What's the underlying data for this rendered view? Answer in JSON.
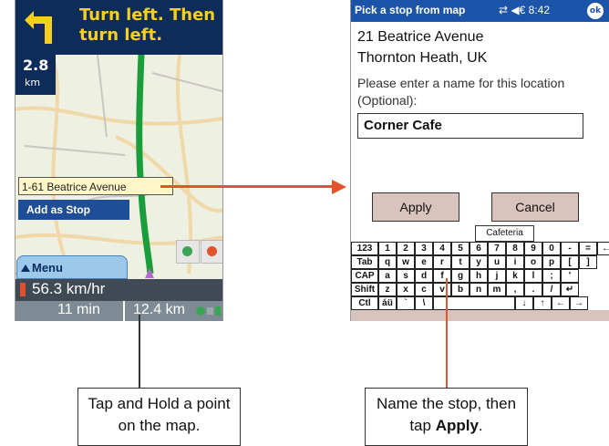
{
  "left_device": {
    "instruction": "Turn left.  Then turn left.",
    "distance_value": "2.8",
    "distance_unit": "km",
    "street_tooltip": "1-61 Beatrice Avenue",
    "add_stop_label": "Add as Stop",
    "menu_label": "Menu",
    "speed": "56.3 km/hr",
    "time_remaining": "11 min",
    "distance_remaining": "12.4 km"
  },
  "right_device": {
    "title": "Pick a stop from map",
    "status_time": "8:42",
    "ok_label": "ok",
    "address_line1": "21 Beatrice Avenue",
    "address_line2": "Thornton Heath, UK",
    "prompt": "Please enter a name for this location (Optional):",
    "name_value": "Corner Cafe",
    "apply_label": "Apply",
    "cancel_label": "Cancel",
    "suggestion": "Cafeteria",
    "keyboard_rows": [
      [
        "123",
        "1",
        "2",
        "3",
        "4",
        "5",
        "6",
        "7",
        "8",
        "9",
        "0",
        "-",
        "=",
        "←"
      ],
      [
        "Tab",
        "q",
        "w",
        "e",
        "r",
        "t",
        "y",
        "u",
        "i",
        "o",
        "p",
        "[",
        "]"
      ],
      [
        "CAP",
        "a",
        "s",
        "d",
        "f",
        "g",
        "h",
        "j",
        "k",
        "l",
        ";",
        "'"
      ],
      [
        "Shift",
        "z",
        "x",
        "c",
        "v",
        "b",
        "n",
        "m",
        ",",
        ".",
        "/",
        "↵"
      ],
      [
        "Ctl",
        "áü",
        "`",
        "\\",
        "",
        "↓",
        "↑",
        "←",
        "→"
      ]
    ]
  },
  "callouts": {
    "left": "Tap and Hold a point on the map.",
    "right_prefix": "Name the stop, then tap ",
    "right_bold": "Apply",
    "right_suffix": "."
  },
  "colors": {
    "nav_blue": "#0d2c5a",
    "instruction_yellow": "#f7cf1c",
    "route_green": "#1a9e3c",
    "arrow_orange": "#e2542b",
    "title_blue": "#1b54a8",
    "button_tan": "#d8c4bc"
  }
}
